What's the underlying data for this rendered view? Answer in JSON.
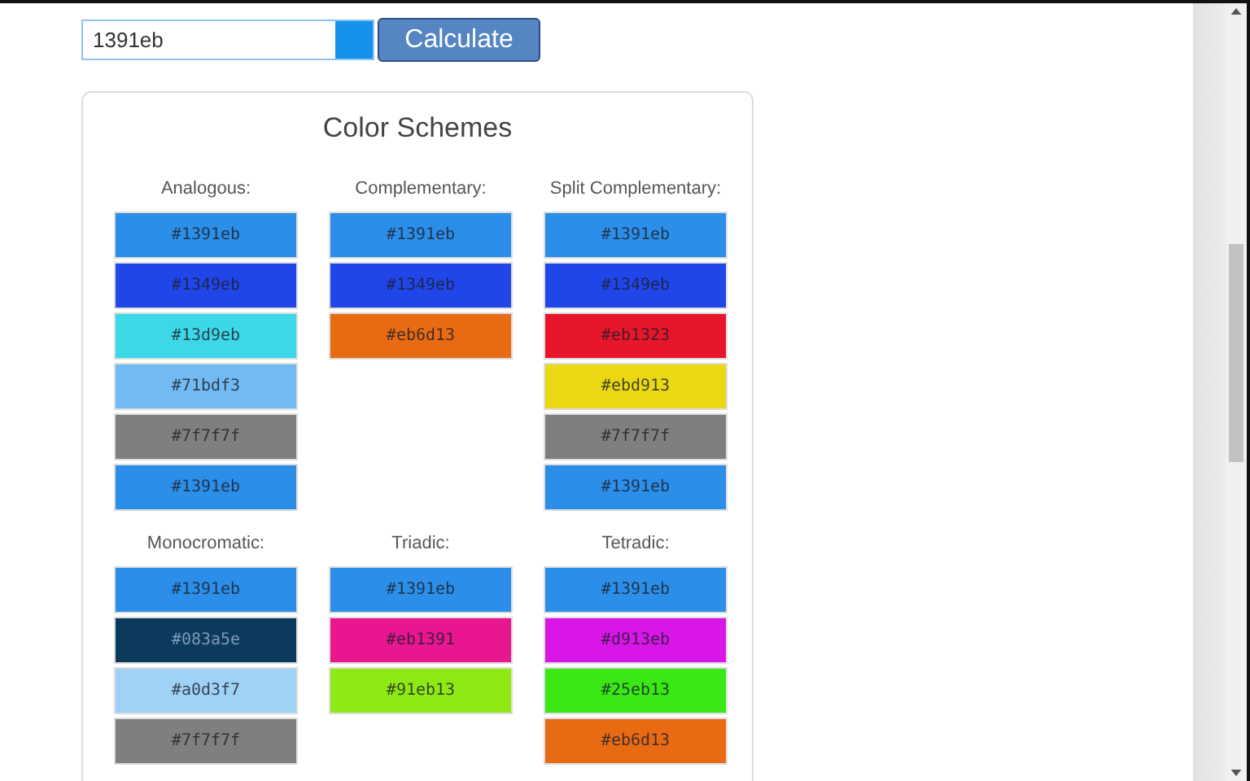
{
  "color_input": {
    "value": "1391eb",
    "color": "#1391eb"
  },
  "calculate_button": "Calculate",
  "card": {
    "title": "Color Schemes",
    "schemes": [
      {
        "name": "Analogous:",
        "swatches": [
          {
            "label": "#1391eb",
            "color": "#2b8fea"
          },
          {
            "label": "#1349eb",
            "color": "#2046ea"
          },
          {
            "label": "#13d9eb",
            "color": "#3dd8e8"
          },
          {
            "label": "#71bdf3",
            "color": "#71bbf2"
          },
          {
            "label": "#7f7f7f",
            "color": "#7f7f7f"
          },
          {
            "label": "#1391eb",
            "color": "#2b8fea"
          }
        ]
      },
      {
        "name": "Complementary:",
        "swatches": [
          {
            "label": "#1391eb",
            "color": "#2b8fea"
          },
          {
            "label": "#1349eb",
            "color": "#2046ea"
          },
          {
            "label": "#eb6d13",
            "color": "#e86b14"
          }
        ]
      },
      {
        "name": "Split Complementary:",
        "swatches": [
          {
            "label": "#1391eb",
            "color": "#2b8fea"
          },
          {
            "label": "#1349eb",
            "color": "#2046ea"
          },
          {
            "label": "#eb1323",
            "color": "#e8162a"
          },
          {
            "label": "#ebd913",
            "color": "#ead814"
          },
          {
            "label": "#7f7f7f",
            "color": "#7f7f7f"
          },
          {
            "label": "#1391eb",
            "color": "#2b8fea"
          }
        ]
      },
      {
        "name": "Monocromatic:",
        "swatches": [
          {
            "label": "#1391eb",
            "color": "#2b8fea"
          },
          {
            "label": "#083a5e",
            "color": "#0b3a5c"
          },
          {
            "label": "#a0d3f7",
            "color": "#a0d2f6"
          },
          {
            "label": "#7f7f7f",
            "color": "#7f7f7f"
          }
        ]
      },
      {
        "name": "Triadic:",
        "swatches": [
          {
            "label": "#1391eb",
            "color": "#2b8fea"
          },
          {
            "label": "#eb1391",
            "color": "#e8168f"
          },
          {
            "label": "#91eb13",
            "color": "#8fea14"
          }
        ]
      },
      {
        "name": "Tetradic:",
        "swatches": [
          {
            "label": "#1391eb",
            "color": "#2b8fea"
          },
          {
            "label": "#d913eb",
            "color": "#d916e8"
          },
          {
            "label": "#25eb13",
            "color": "#3ae816"
          },
          {
            "label": "#eb6d13",
            "color": "#e86b14"
          }
        ]
      }
    ]
  }
}
